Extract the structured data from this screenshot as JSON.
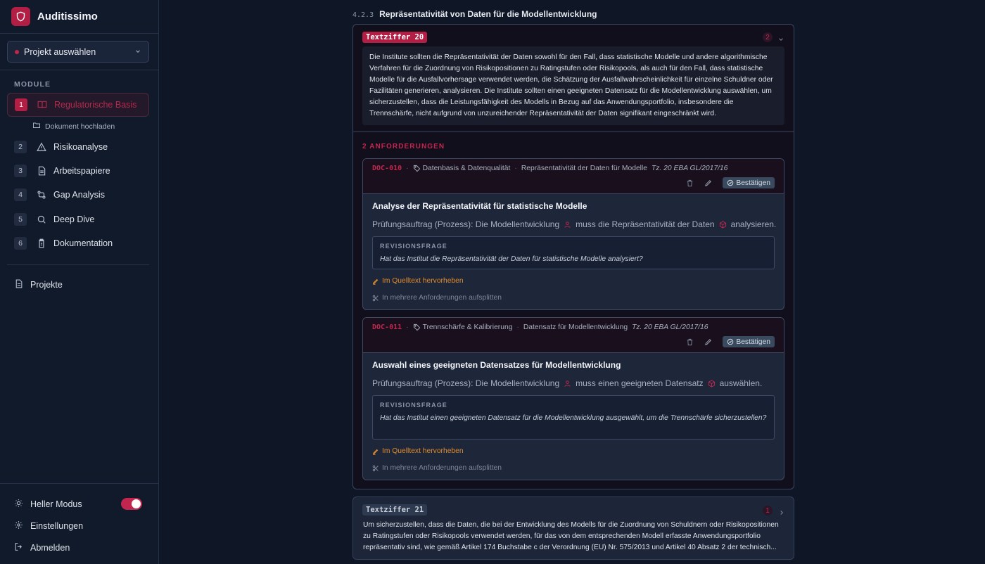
{
  "app": {
    "name": "Auditissimo"
  },
  "sidebar": {
    "project_select": "Projekt auswählen",
    "section_label": "MODULE",
    "items": [
      {
        "num": "1",
        "label": "Regulatorische Basis",
        "icon": "book-open-icon"
      },
      {
        "num": "2",
        "label": "Risikoanalyse",
        "icon": "warning-icon"
      },
      {
        "num": "3",
        "label": "Arbeitspapiere",
        "icon": "document-icon"
      },
      {
        "num": "4",
        "label": "Gap Analysis",
        "icon": "compare-arrows-icon"
      },
      {
        "num": "5",
        "label": "Deep Dive",
        "icon": "search-icon"
      },
      {
        "num": "6",
        "label": "Dokumentation",
        "icon": "clipboard-icon"
      }
    ],
    "sub_item": "Dokument hochladen",
    "projects": "Projekte",
    "light_mode": "Heller Modus",
    "settings": "Einstellungen",
    "logout": "Abmelden"
  },
  "main": {
    "section_num": "4.2.3",
    "section_title": "Repräsentativität von Daten für die Modellentwicklung",
    "tz20": {
      "badge": "Textziffer 20",
      "count": "2",
      "text": "Die Institute sollten die Repräsentativität der Daten sowohl für den Fall, dass statistische Modelle und andere algorithmische Verfahren für die Zuordnung von Risikopositionen zu Ratingstufen oder Risikopools, als auch für den Fall, dass statistische Modelle für die Ausfallvorhersage verwendet werden, die Schätzung der Ausfallwahrscheinlichkeit für einzelne Schuldner oder Fazilitäten generieren, analysieren. Die Institute sollten einen geeigneten Datensatz für die Modellentwicklung auswählen, um sicherzustellen, dass die Leistungsfähigkeit des Modells in Bezug auf das Anwendungsportfolio, insbesondere die Trennschärfe, nicht aufgrund von unzureichender Repräsentativität der Daten signifikant eingeschränkt wird."
    },
    "req_header": "2 ANFORDERUNGEN",
    "requirements": [
      {
        "id": "DOC-010",
        "category": "Datenbasis & Datenqualität",
        "topic": "Repräsentativität der Daten für Modelle",
        "ref": "Tz. 20 EBA GL/2017/16",
        "confirm": "Bestätigen",
        "title": "Analyse der Repräsentativität für statistische Modelle",
        "s1": "Prüfungsauftrag (Prozess): Die Modellentwicklung",
        "s2": "muss die Repräsentativität der Daten",
        "s3": "analysieren.",
        "rev_label": "REVISIONSFRAGE",
        "rev_q": "Hat das Institut die Repräsentativität der Daten für statistische Modelle analysiert?",
        "highlight": "Im Quelltext hervorheben",
        "split": "In mehrere Anforderungen aufsplitten"
      },
      {
        "id": "DOC-011",
        "category": "Trennschärfe & Kalibrierung",
        "topic": "Datensatz für Modellentwicklung",
        "ref": "Tz. 20 EBA GL/2017/16",
        "confirm": "Bestätigen",
        "title": "Auswahl eines geeigneten Datensatzes für Modellentwicklung",
        "s1": "Prüfungsauftrag (Prozess): Die Modellentwicklung",
        "s2": "muss einen geeigneten Datensatz",
        "s3": "auswählen.",
        "rev_label": "REVISIONSFRAGE",
        "rev_q": "Hat das Institut einen geeigneten Datensatz für die Modellentwicklung ausgewählt, um die Trennschärfe sicherzustellen?",
        "highlight": "Im Quelltext hervorheben",
        "split": "In mehrere Anforderungen aufsplitten"
      }
    ],
    "tz21": {
      "badge": "Textziffer 21",
      "count": "1",
      "text": "Um sicherzustellen, dass die Daten, die bei der Entwicklung des Modells für die Zuordnung von Schuldnern oder Risikopositionen zu Ratingstufen oder Risikopools verwendet werden, für das von dem entsprechenden Modell erfasste Anwendungsportfolio repräsentativ sind, wie gemäß Artikel 174 Buchstabe c der Verordnung (EU) Nr. 575/2013 und Artikel 40 Absatz 2 der technisch..."
    }
  },
  "colors": {
    "accent": "#c2264e",
    "brand": "#b31e45",
    "orange": "#e08a2c"
  }
}
